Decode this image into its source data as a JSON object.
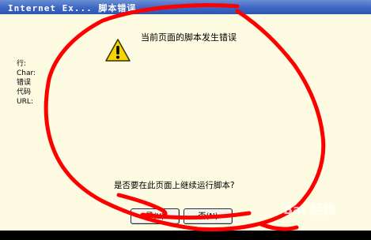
{
  "window": {
    "title": "Internet Ex... 脚本错误"
  },
  "dialog": {
    "message": "当前页面的脚本发生错误",
    "labels": [
      "行:",
      "Char:",
      "错误",
      "代码",
      "URL:"
    ],
    "question": "是否要在此页面上继续运行脚本?",
    "yes_label": "是(Y)",
    "no_label": "否(N)"
  },
  "overlay": {
    "stroke_color": "#ff0000",
    "watermark": "Bai 经验"
  }
}
